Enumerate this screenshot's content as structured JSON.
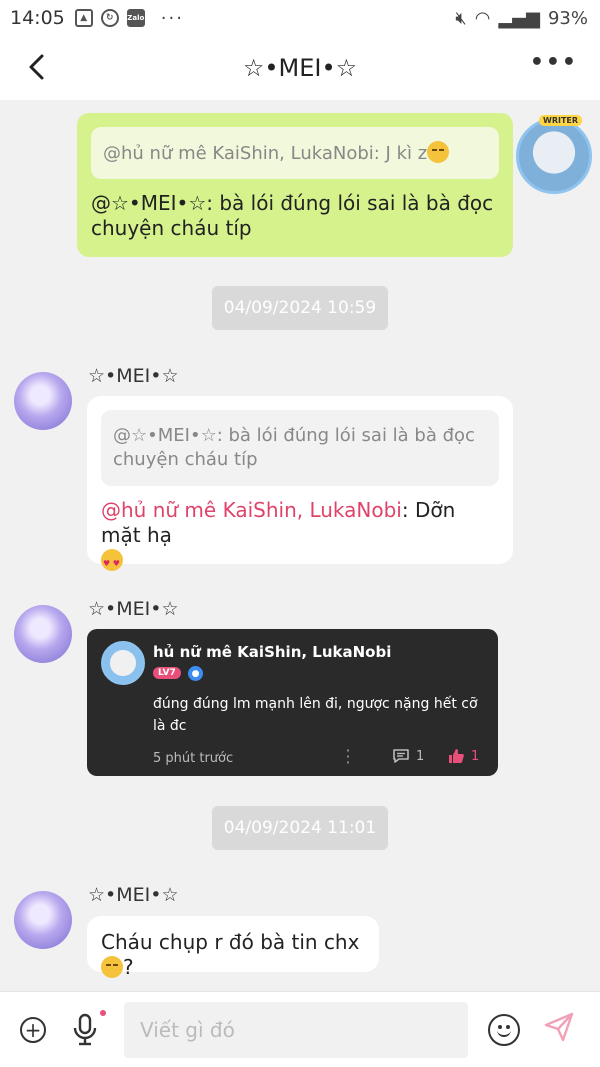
{
  "status_bar": {
    "time": "14:05",
    "more": "···",
    "zalo_label": "Zalo",
    "battery": "93%"
  },
  "header": {
    "title": "☆•MEI•☆"
  },
  "messages": {
    "outgoing": {
      "quote": "@hủ nữ mê KaiShin, LukaNobi: J kì z",
      "text": "@☆•MEI•☆: bà lói đúng lói sai là bà đọc chuyện cháu típ",
      "avatar_badge": "WRITER"
    },
    "timestamp_1": "04/09/2024 10:59",
    "reply_1": {
      "sender": "☆•MEI•☆",
      "quote": "@☆•MEI•☆: bà lói đúng lói sai là bà đọc chuyện cháu típ",
      "mention": "@hủ nữ mê KaiShin, LukaNobi",
      "text": ": Dỡn mặt hạ"
    },
    "reply_2": {
      "sender": "☆•MEI•☆",
      "card": {
        "author": "hủ nữ mê KaiShin, LukaNobi",
        "level": "LV7",
        "text": "đúng đúng lm mạnh lên đi, ngược nặng hết cỡ là đc",
        "time": "5 phút trước",
        "comments": "1",
        "likes": "1"
      }
    },
    "timestamp_2": "04/09/2024 11:01",
    "reply_3": {
      "sender": "☆•MEI•☆",
      "text_before": "Cháu chụp r đó bà tin chx",
      "text_after": "?"
    }
  },
  "composer": {
    "placeholder": "Viết gì đó"
  }
}
